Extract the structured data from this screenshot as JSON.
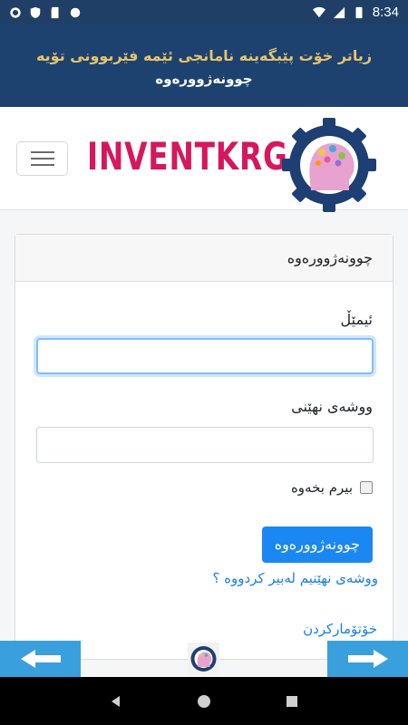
{
  "status_bar": {
    "time": "8:34",
    "left_icons": [
      "gear-icon",
      "shield-icon",
      "sd-card-icon",
      "circle-icon"
    ],
    "right_icons": [
      "wifi-icon",
      "signal-icon",
      "battery-icon"
    ]
  },
  "banner": {
    "text": "زیاتر خۆت پێبگەینە نامانجی ئێمە فێربوونی تۆیە",
    "link": "چوونەژوورەوە"
  },
  "header": {
    "brand": "INVENTKRG",
    "menu_icon": "hamburger-icon"
  },
  "login": {
    "title": "چوونەژوورەوە",
    "email_label": "ئیمێڵ",
    "email_value": "",
    "password_label": "ووشەی نهێنی",
    "password_value": "",
    "remember_label": "بیرم بخەوە",
    "remember_checked": false,
    "submit_label": "چوونەژوورەوە",
    "forgot_label": "ووشەی نهێنیم لەبیر کردووە ؟",
    "register_label": "خۆتۆمارکردن"
  },
  "bottom_nav": {
    "prev_icon": "arrow-left-icon",
    "next_icon": "arrow-right-icon",
    "logo_icon": "brain-gear-logo"
  },
  "colors": {
    "banner_bg": "#1d4270",
    "banner_text": "#e7c36b",
    "brand": "#d6175e",
    "primary": "#1a88f0",
    "nav_button": "#3aa0dd"
  }
}
